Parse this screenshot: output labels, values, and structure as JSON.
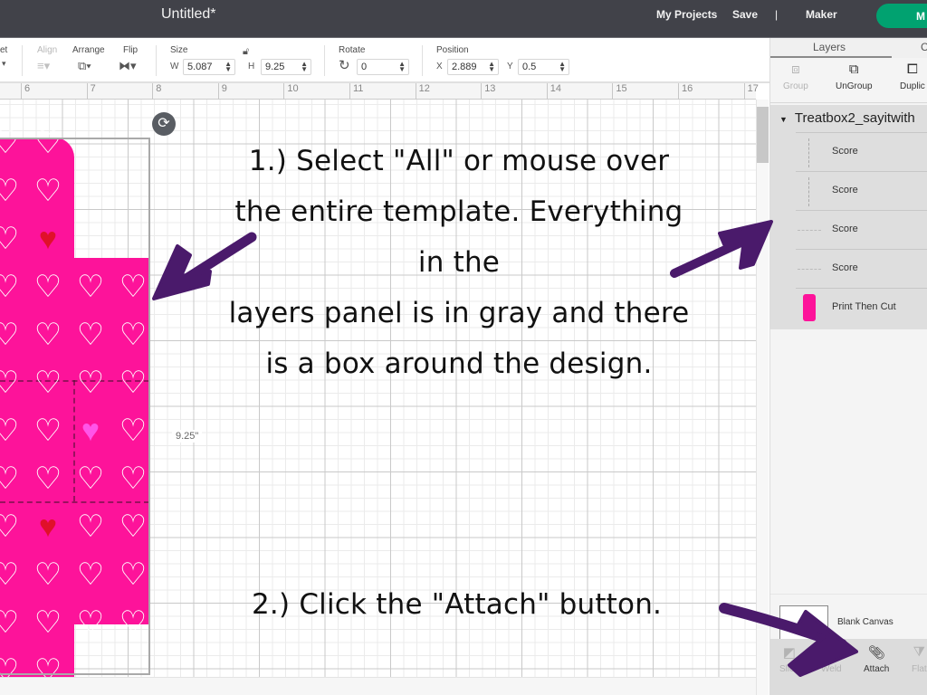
{
  "app": {
    "title": "Untitled*",
    "nav": [
      "My Projects",
      "Save",
      "|",
      "Maker"
    ],
    "make_button": "M"
  },
  "toolbar": {
    "offset_label": "et",
    "align_label": "Align",
    "arrange_label": "Arrange",
    "flip_label": "Flip",
    "size_label": "Size",
    "w_label": "W",
    "w_value": "5.087",
    "h_label": "H",
    "h_value": "9.25",
    "rotate_label": "Rotate",
    "rotate_value": "0",
    "position_label": "Position",
    "x_label": "X",
    "x_value": "2.889",
    "y_label": "Y",
    "y_value": "0.5"
  },
  "ruler": {
    "ticks": [
      "6",
      "7",
      "8",
      "9",
      "10",
      "11",
      "12",
      "13",
      "14",
      "15",
      "16",
      "17"
    ]
  },
  "canvas": {
    "dimension_label": "9.25\"",
    "instruction_1": [
      "1.) Select \"All\" or mouse over",
      "the entire template. Everything",
      "in the",
      "layers panel is in gray and there",
      "is a box around the design."
    ],
    "instruction_2": "2.) Click the \"Attach\" button.",
    "colors": {
      "design_pink": "#fd139a",
      "annotation_arrow": "#4a1a6b"
    }
  },
  "panel": {
    "tabs": [
      "Layers",
      "C"
    ],
    "tools": [
      {
        "label": "Group",
        "enabled": false
      },
      {
        "label": "UnGroup",
        "enabled": true
      },
      {
        "label": "Duplic",
        "enabled": true
      }
    ],
    "group_name": "Treatbox2_sayitwith",
    "layers": [
      {
        "label": "Score",
        "thumb": "vertical-score"
      },
      {
        "label": "Score",
        "thumb": "vertical-score"
      },
      {
        "label": "Score",
        "thumb": "horizontal-score"
      },
      {
        "label": "Score",
        "thumb": "horizontal-score"
      },
      {
        "label": "Print Then Cut",
        "thumb": "pink-design"
      }
    ],
    "blank_canvas_label": "Blank Canvas",
    "bottom_tools": [
      {
        "label": "Slice",
        "enabled": false
      },
      {
        "label": "Weld",
        "enabled": false
      },
      {
        "label": "Attach",
        "enabled": true
      },
      {
        "label": "Flat",
        "enabled": false
      }
    ]
  }
}
